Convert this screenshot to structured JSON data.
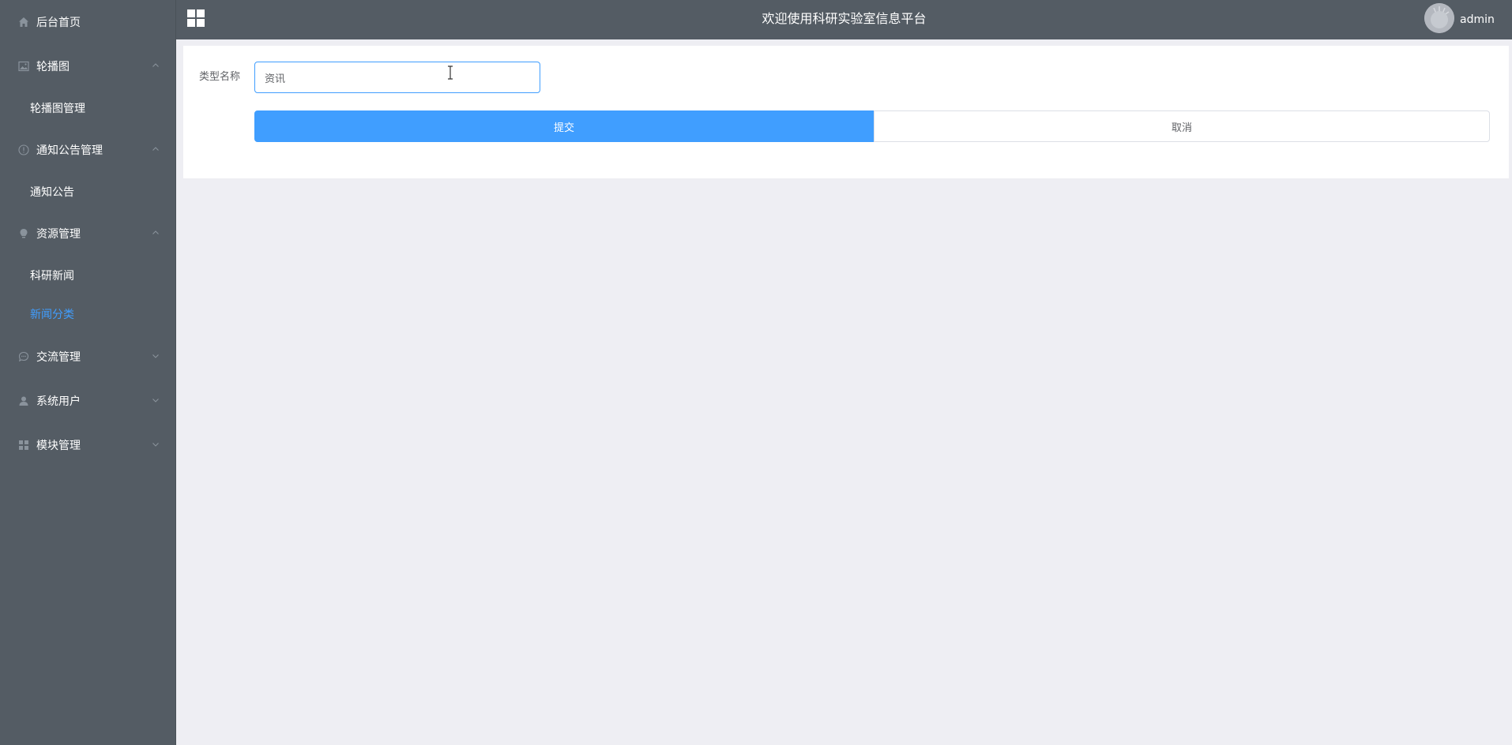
{
  "sidebar": {
    "items": [
      {
        "label": "后台首页",
        "icon": "home-icon"
      },
      {
        "label": "轮播图",
        "icon": "picture-icon",
        "expanded": true,
        "children": [
          {
            "label": "轮播图管理"
          }
        ]
      },
      {
        "label": "通知公告管理",
        "icon": "info-icon",
        "expanded": true,
        "children": [
          {
            "label": "通知公告"
          }
        ]
      },
      {
        "label": "资源管理",
        "icon": "bulb-icon",
        "expanded": true,
        "children": [
          {
            "label": "科研新闻"
          },
          {
            "label": "新闻分类",
            "active": true
          }
        ]
      },
      {
        "label": "交流管理",
        "icon": "chat-icon",
        "expanded": false
      },
      {
        "label": "系统用户",
        "icon": "user-icon",
        "expanded": false
      },
      {
        "label": "模块管理",
        "icon": "grid-icon",
        "expanded": false
      }
    ]
  },
  "header": {
    "title": "欢迎使用科研实验室信息平台",
    "username": "admin"
  },
  "form": {
    "type_name_label": "类型名称",
    "type_name_value": "资讯",
    "submit_label": "提交",
    "cancel_label": "取消"
  },
  "colors": {
    "sidebar_bg": "#545c64",
    "accent": "#409eff",
    "page_bg": "#eeeef3"
  }
}
